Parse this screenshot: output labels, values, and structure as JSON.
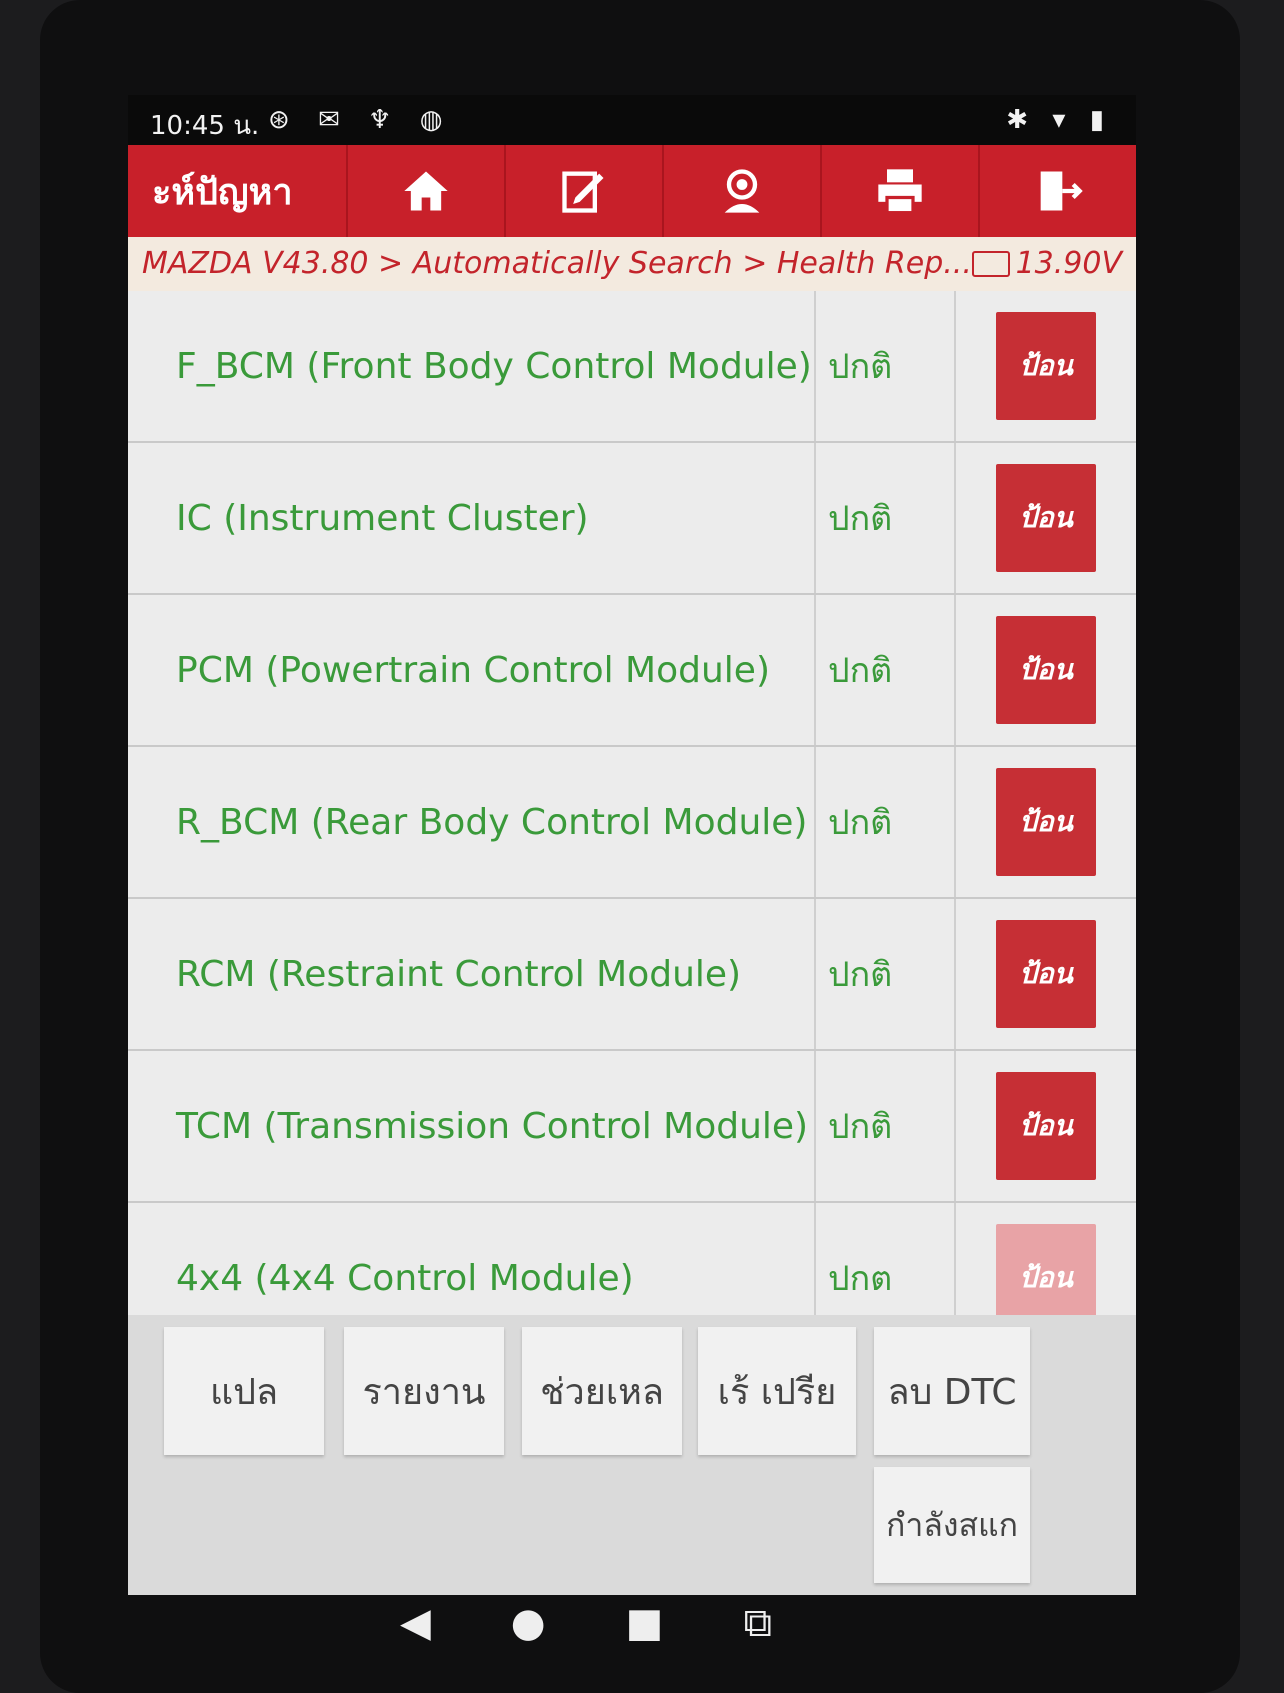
{
  "status_bar": {
    "time": "10:45 น.",
    "left_icons": [
      "notification-icon",
      "mail-icon",
      "stethoscope-icon",
      "globe-icon"
    ],
    "right_icons": [
      "bluetooth-icon",
      "wifi-icon",
      "battery-icon"
    ]
  },
  "toolbar": {
    "title": "ะห์ปัญหา",
    "buttons": [
      "home-icon",
      "edit-icon",
      "support-icon",
      "print-icon",
      "exit-icon"
    ],
    "color": "#c8202a"
  },
  "breadcrumb": {
    "path": "MAZDA V43.80 > Automatically Search > Health Rep...",
    "voltage": "13.90V"
  },
  "modules": [
    {
      "name": "F_BCM (Front Body Control Module)",
      "status": "ปกติ",
      "action": "ป้อน"
    },
    {
      "name": "IC (Instrument Cluster)",
      "status": "ปกติ",
      "action": "ป้อน"
    },
    {
      "name": "PCM (Powertrain Control Module)",
      "status": "ปกติ",
      "action": "ป้อน"
    },
    {
      "name": "R_BCM (Rear Body Control Module)",
      "status": "ปกติ",
      "action": "ป้อน"
    },
    {
      "name": "RCM (Restraint Control Module)",
      "status": "ปกติ",
      "action": "ป้อน"
    },
    {
      "name": "TCM (Transmission Control Module)",
      "status": "ปกติ",
      "action": "ป้อน"
    },
    {
      "name": "4x4 (4x4 Control Module)",
      "status": "ปกต",
      "action": "ป้อน"
    }
  ],
  "bottom_buttons": {
    "translate": "แปล",
    "report": "รายงาน",
    "help": "ช่วยเหล",
    "compare": "เร้ เปรีย",
    "clear_dtc": "ลบ DTC",
    "scanning": "กำลังสแก"
  },
  "colors": {
    "module_text": "#3a9a3a",
    "enter_button": "#c62f35",
    "breadcrumb_bg": "#f3eadf"
  }
}
